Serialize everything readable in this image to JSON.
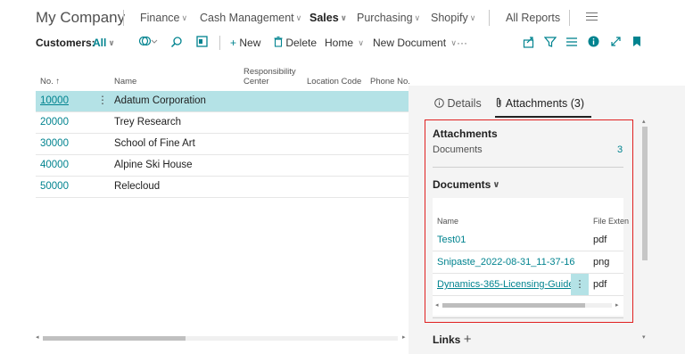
{
  "nav": {
    "company": "My Company",
    "items": [
      {
        "label": "Finance",
        "chevron": true
      },
      {
        "label": "Cash Management",
        "chevron": true
      },
      {
        "label": "Sales",
        "chevron": true,
        "active": true
      },
      {
        "label": "Purchasing",
        "chevron": true
      },
      {
        "label": "Shopify",
        "chevron": true
      },
      {
        "label": "All Reports",
        "chevron": false
      }
    ],
    "chevron_glyph": "∨",
    "menu_icon": "hamburger-icon"
  },
  "actionbar": {
    "customers_label": "Customers:",
    "filter_value": "All",
    "chevron_glyph": "∨",
    "new_label": "New",
    "delete_label": "Delete",
    "home_label": "Home",
    "newdoc_label": "New Document",
    "more_glyph": "···",
    "plus_glyph": "+",
    "icons": [
      "view-toggle-icon",
      "search-icon",
      "table-icon",
      "trash-icon",
      "share-icon",
      "filter-icon",
      "list-icon",
      "info-icon",
      "expand-icon",
      "bookmark-icon"
    ]
  },
  "list": {
    "headers": {
      "no": "No. ↑",
      "name": "Name",
      "resp_line1": "Responsibility",
      "resp_line2": "Center",
      "location": "Location Code",
      "phone": "Phone No."
    },
    "row_menu_glyph": "⋮",
    "rows": [
      {
        "no": "10000",
        "name": "Adatum Corporation",
        "selected": true
      },
      {
        "no": "20000",
        "name": "Trey Research"
      },
      {
        "no": "30000",
        "name": "School of Fine Art"
      },
      {
        "no": "40000",
        "name": "Alpine Ski House"
      },
      {
        "no": "50000",
        "name": "Relecloud"
      }
    ]
  },
  "factbox": {
    "tab_details": "Details",
    "tab_attachments": "Attachments (3)",
    "details_icon": "info-icon",
    "attachments_icon": "paperclip-icon",
    "attachments_title": "Attachments",
    "documents_label": "Documents",
    "documents_count": "3",
    "documents_section": "Documents",
    "documents_chevron": "∨",
    "table_headers": {
      "name": "Name",
      "ext": "File Exten"
    },
    "files": [
      {
        "name": "Test01",
        "ext": "pdf"
      },
      {
        "name": "Snipaste_2022-08-31_11-37-16",
        "ext": "png"
      },
      {
        "name": "Dynamics-365-Licensing-Guide-...",
        "ext": "pdf",
        "active": true
      }
    ],
    "row_menu_glyph": "⋮",
    "links_label": "Links",
    "links_plus": "+"
  },
  "colors": {
    "accent": "#00838f",
    "selected_row": "#b4e2e6",
    "highlight_border": "#e02020"
  }
}
